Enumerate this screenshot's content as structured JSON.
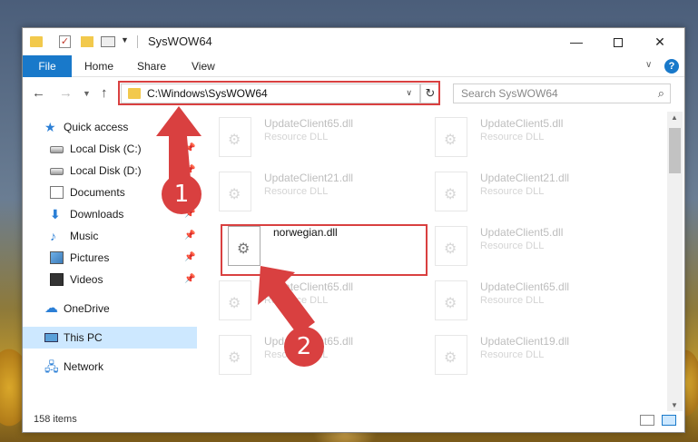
{
  "window": {
    "title": "SysWOW64"
  },
  "ribbon": {
    "tabs": [
      "File",
      "Home",
      "Share",
      "View"
    ]
  },
  "address": {
    "path": "C:\\Windows\\SysWOW64"
  },
  "search": {
    "placeholder": "Search SysWOW64"
  },
  "sidebar": {
    "quick_access": "Quick access",
    "items": [
      {
        "label": "Local Disk (C:)",
        "icon": "disk-icon"
      },
      {
        "label": "Local Disk (D:)",
        "icon": "disk-icon"
      },
      {
        "label": "Documents",
        "icon": "documents-icon"
      },
      {
        "label": "Downloads",
        "icon": "downloads-icon"
      },
      {
        "label": "Music",
        "icon": "music-icon"
      },
      {
        "label": "Pictures",
        "icon": "pictures-icon"
      },
      {
        "label": "Videos",
        "icon": "videos-icon"
      }
    ],
    "onedrive": "OneDrive",
    "this_pc": "This PC",
    "network": "Network"
  },
  "files": {
    "left": [
      {
        "name": "UpdateClient65.dll",
        "desc": "Resource DLL"
      },
      {
        "name": "UpdateClient21.dll",
        "desc": "Resource DLL"
      },
      {
        "name": "norwegian.dll",
        "desc": ""
      },
      {
        "name": "UpdateClient65.dll",
        "desc": "Resource DLL"
      },
      {
        "name": "UpdateClient65.dll",
        "desc": "Resource DLL"
      }
    ],
    "right": [
      {
        "name": "UpdateClient5.dll",
        "desc": "Resource DLL"
      },
      {
        "name": "UpdateClient21.dll",
        "desc": "Resource DLL"
      },
      {
        "name": "UpdateClient5.dll",
        "desc": "Resource DLL"
      },
      {
        "name": "UpdateClient65.dll",
        "desc": "Resource DLL"
      },
      {
        "name": "UpdateClient19.dll",
        "desc": "Resource DLL"
      }
    ]
  },
  "status": {
    "count": "158 items"
  },
  "annotations": {
    "step1": "1",
    "step2": "2",
    "color": "#d94040"
  },
  "colors": {
    "accent": "#1979ca",
    "selection": "#cde8ff"
  }
}
